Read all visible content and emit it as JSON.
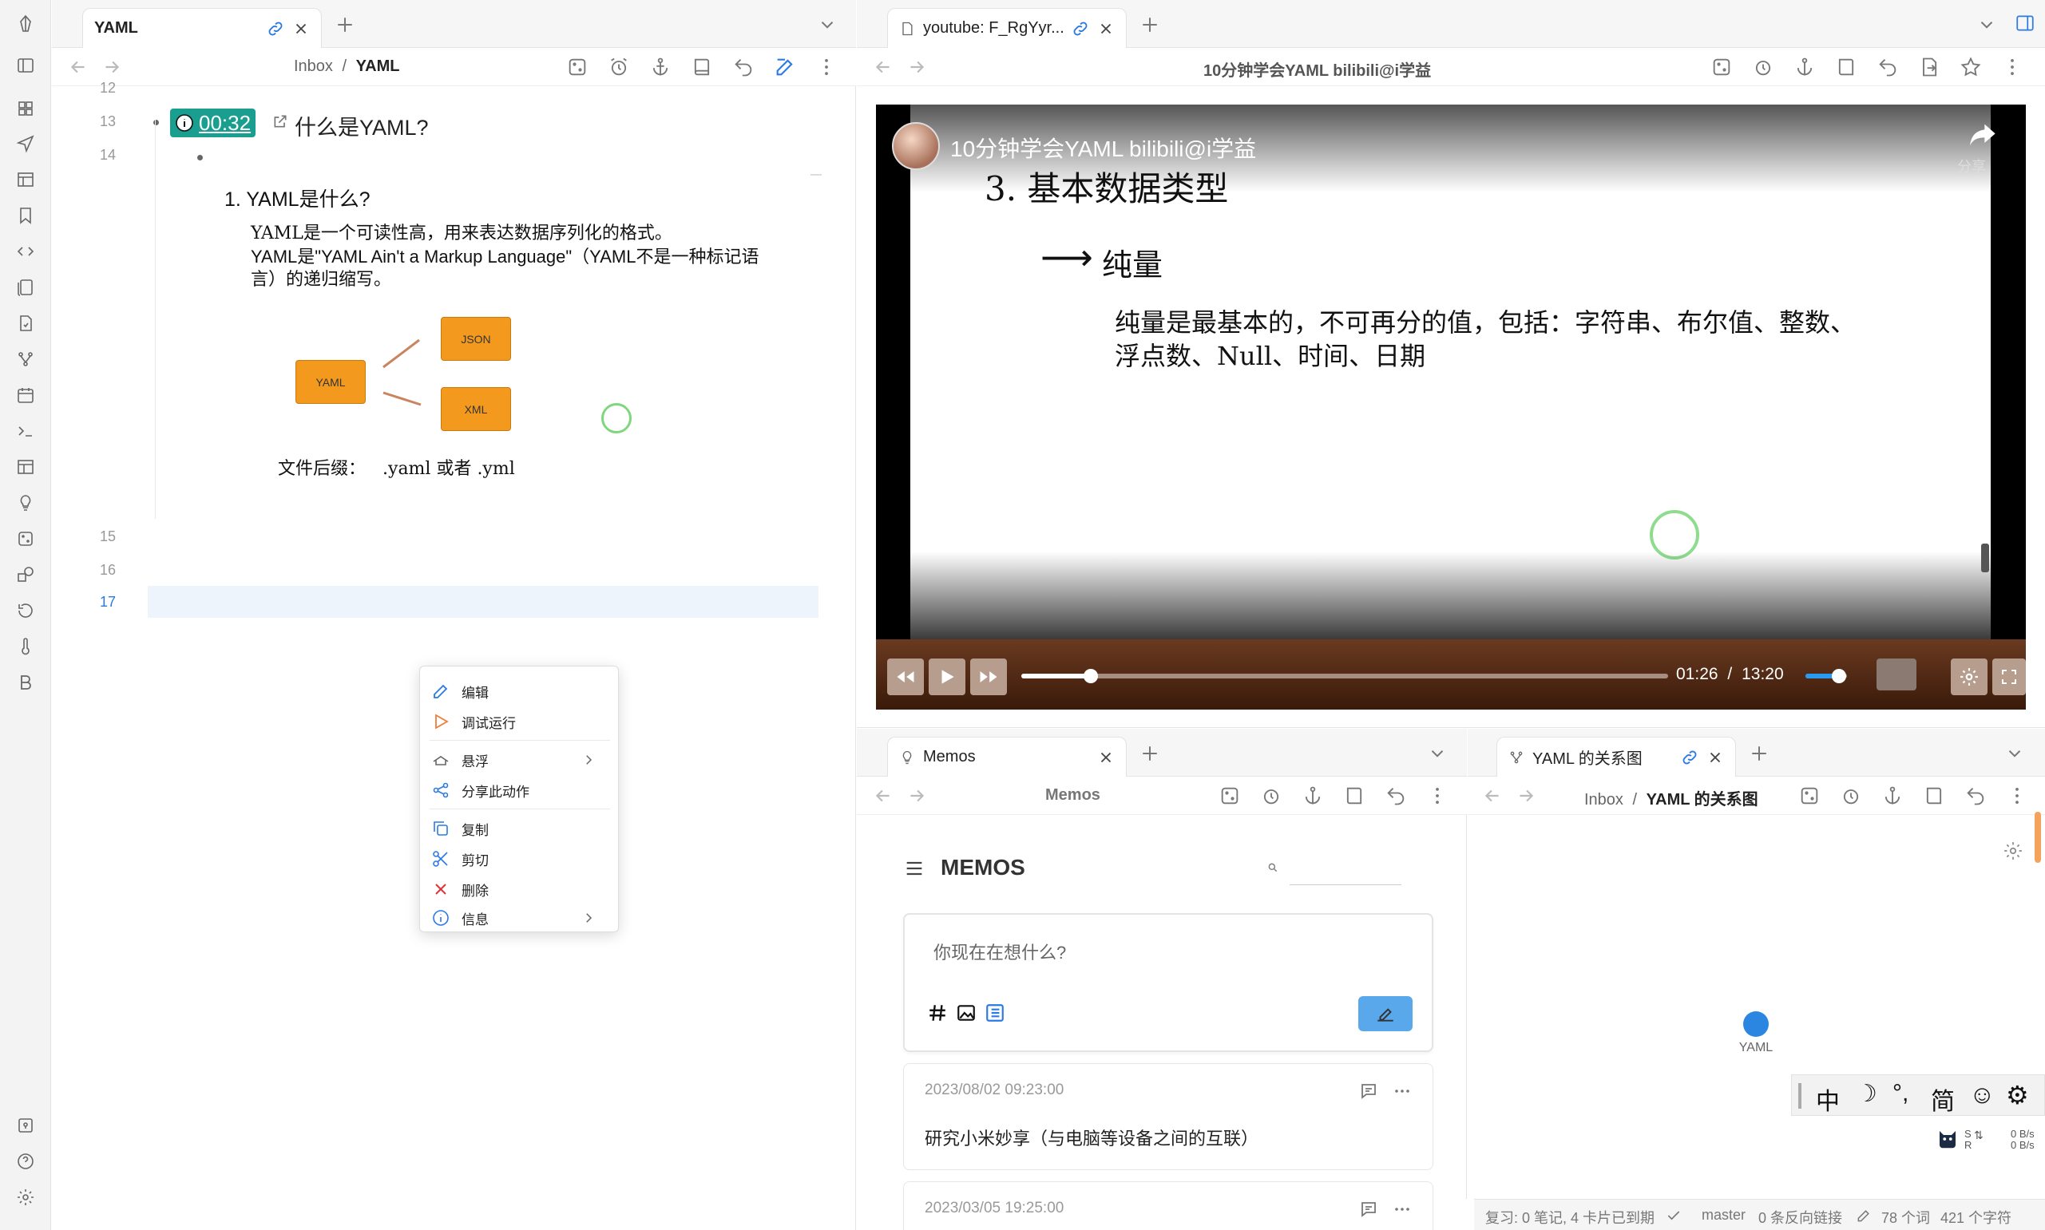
{
  "left_pane": {
    "tab_title": "YAML",
    "breadcrumb_parent": "Inbox",
    "breadcrumb_sep": "/",
    "breadcrumb_current": "YAML",
    "line_numbers": [
      "12",
      "13",
      "14",
      "15",
      "16",
      "17"
    ],
    "timestamp_link": "00:32",
    "heading": "什么是YAML?",
    "content": {
      "item_title": "1. YAML是什么?",
      "para1": "YAML是一个可读性高，用来表达数据序列化的格式。",
      "para2a": "YAML是\"YAML Ain't a Markup Language\"（YAML不是一种标记语",
      "para2b": "言）的递归缩写。",
      "diagram_yaml": "YAML",
      "diagram_json": "JSON",
      "diagram_xml": "XML",
      "suffix_label": "文件后缀：",
      "suffix_value": ".yaml 或者 .yml"
    }
  },
  "context_menu": {
    "items": [
      {
        "label": "编辑",
        "icon": "pencil-icon",
        "color": "#2a7ae4"
      },
      {
        "label": "调试运行",
        "icon": "play-icon",
        "color": "#ef7d3a"
      },
      {
        "label": "悬浮",
        "icon": "float-icon",
        "color": "#666"
      },
      {
        "label": "分享此动作",
        "icon": "share-icon",
        "color": "#2a7ae4"
      },
      {
        "label": "复制",
        "icon": "copy-icon",
        "color": "#2a7ae4"
      },
      {
        "label": "剪切",
        "icon": "scissors-icon",
        "color": "#2a7ae4"
      },
      {
        "label": "删除",
        "icon": "delete-icon",
        "color": "#e0323a"
      },
      {
        "label": "信息",
        "icon": "info-icon",
        "color": "#2a7ae4"
      }
    ]
  },
  "video_pane": {
    "tab_title": "youtube: F_RgYyr...",
    "nav_title": "10分钟学会YAML bilibili@i学益",
    "video_title": "10分钟学会YAML bilibili@i学益",
    "share_label": "分享",
    "slide_heading": "3. 基本数据类型",
    "slide_arrow": "⟶",
    "slide_sub": "纯量",
    "slide_body1": "纯量是最基本的，不可再分的值，包括：字符串、布尔值、整数、",
    "slide_body2": "浮点数、Null、时间、日期",
    "current_time": "01:26",
    "time_sep": "/",
    "duration": "13:20",
    "progress": 0.1075,
    "volume": 0.8
  },
  "memos_pane": {
    "tab_title": "Memos",
    "nav_title": "Memos",
    "header": "MEMOS",
    "input_placeholder": "你现在在想什么?",
    "memos": [
      {
        "time": "2023/08/02 09:23:00",
        "text": "研究小米妙享（与电脑等设备之间的互联）"
      },
      {
        "time": "2023/03/05 19:25:00",
        "text": ""
      }
    ]
  },
  "graph_pane": {
    "tab_title": "YAML 的关系图",
    "breadcrumb_parent": "Inbox",
    "breadcrumb_sep": "/",
    "breadcrumb_current": "YAML 的关系图",
    "node_label": "YAML",
    "node_color": "#2a86e0"
  },
  "ime_bar": {
    "items": [
      "中",
      "☽",
      "°,",
      "简",
      "☺",
      "⚙"
    ]
  },
  "net_speed": {
    "up": "0 B/s",
    "down": "0 B/s",
    "s": "S",
    "r": "R"
  },
  "status_bar": {
    "review": "复习: 0 笔记, 4 卡片已到期",
    "branch": "master",
    "backlinks": "0 条反向链接",
    "words": "78 个词",
    "chars": "421 个字符"
  },
  "colors": {
    "accent": "#2a7ae4",
    "timestamp_bg": "#1a9e8f",
    "diagram_orange": "#f39a1e"
  }
}
